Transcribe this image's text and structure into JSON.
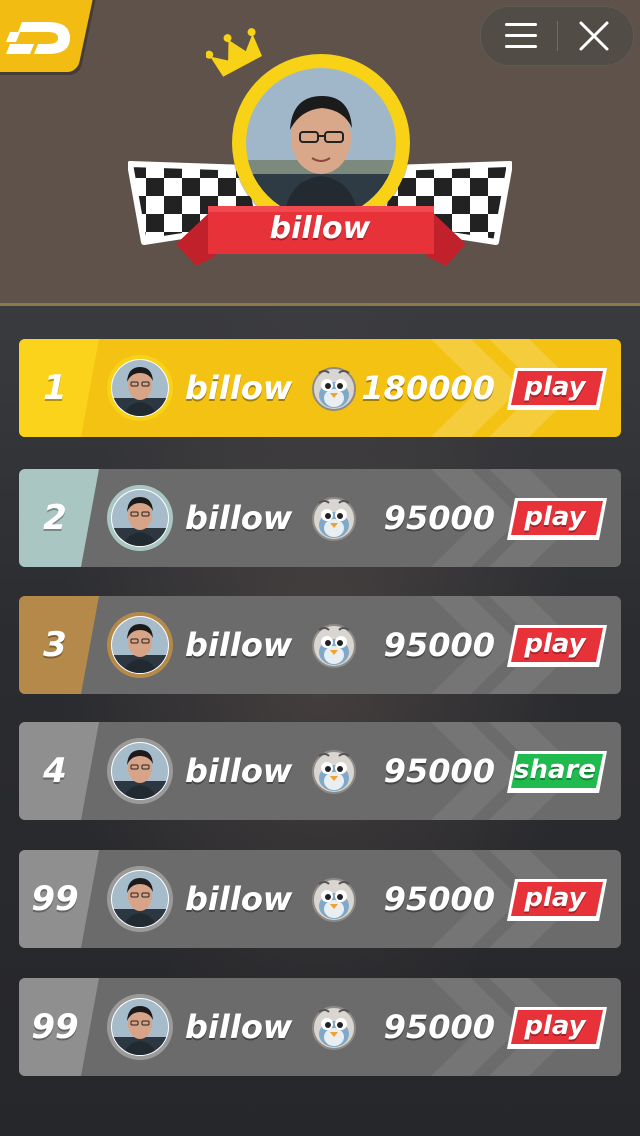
{
  "header": {
    "player_name": "billow"
  },
  "colors": {
    "gold": "#f3c212",
    "silver": "#a9c6c2",
    "bronze": "#b5894a",
    "grey": "#8f8f8f",
    "row_bg": "#6b6b6b",
    "play_red": "#e8323a",
    "share_green": "#1fbb4f"
  },
  "rows": [
    {
      "rank": "1",
      "name": "billow",
      "score": "180000",
      "action": "play",
      "action_kind": "play"
    },
    {
      "rank": "2",
      "name": "billow",
      "score": "95000",
      "action": "play",
      "action_kind": "play"
    },
    {
      "rank": "3",
      "name": "billow",
      "score": "95000",
      "action": "play",
      "action_kind": "play"
    },
    {
      "rank": "4",
      "name": "billow",
      "score": "95000",
      "action": "share",
      "action_kind": "share"
    },
    {
      "rank": "99",
      "name": "billow",
      "score": "95000",
      "action": "play",
      "action_kind": "play"
    },
    {
      "rank": "99",
      "name": "billow",
      "score": "95000",
      "action": "play",
      "action_kind": "play"
    }
  ]
}
